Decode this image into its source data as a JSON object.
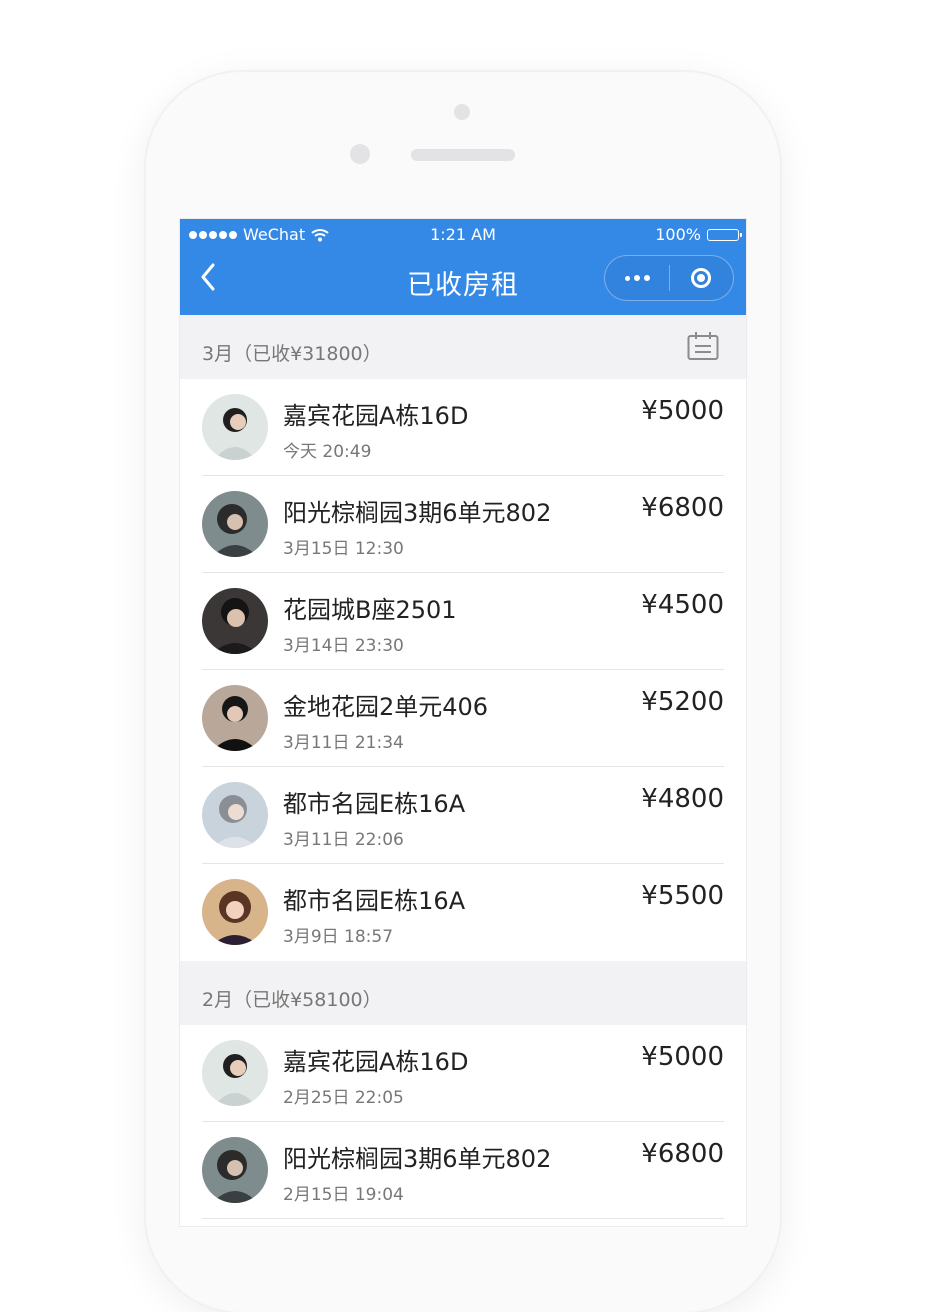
{
  "status_bar": {
    "carrier": "WeChat",
    "time": "1:21 AM",
    "battery": "100%"
  },
  "navbar": {
    "title": "已收房租"
  },
  "sections": [
    {
      "label": "3月（已收¥31800）",
      "items": [
        {
          "name": "嘉宾花园A栋16D",
          "date": "今天  20:49",
          "amount": "¥5000"
        },
        {
          "name": "阳光棕榈园3期6单元802",
          "date": "3月15日  12:30",
          "amount": "¥6800"
        },
        {
          "name": "花园城B座2501",
          "date": "3月14日  23:30",
          "amount": "¥4500"
        },
        {
          "name": "金地花园2单元406",
          "date": "3月11日  21:34",
          "amount": "¥5200"
        },
        {
          "name": "都市名园E栋16A",
          "date": "3月11日  22:06",
          "amount": "¥4800"
        },
        {
          "name": "都市名园E栋16A",
          "date": "3月9日  18:57",
          "amount": "¥5500"
        }
      ]
    },
    {
      "label": "2月（已收¥58100）",
      "items": [
        {
          "name": "嘉宾花园A栋16D",
          "date": "2月25日  22:05",
          "amount": "¥5000"
        },
        {
          "name": "阳光棕榈园3期6单元802",
          "date": "2月15日  19:04",
          "amount": "¥6800"
        }
      ]
    }
  ],
  "colors": {
    "accent": "#3589e6",
    "section_bg": "#f2f2f4"
  }
}
